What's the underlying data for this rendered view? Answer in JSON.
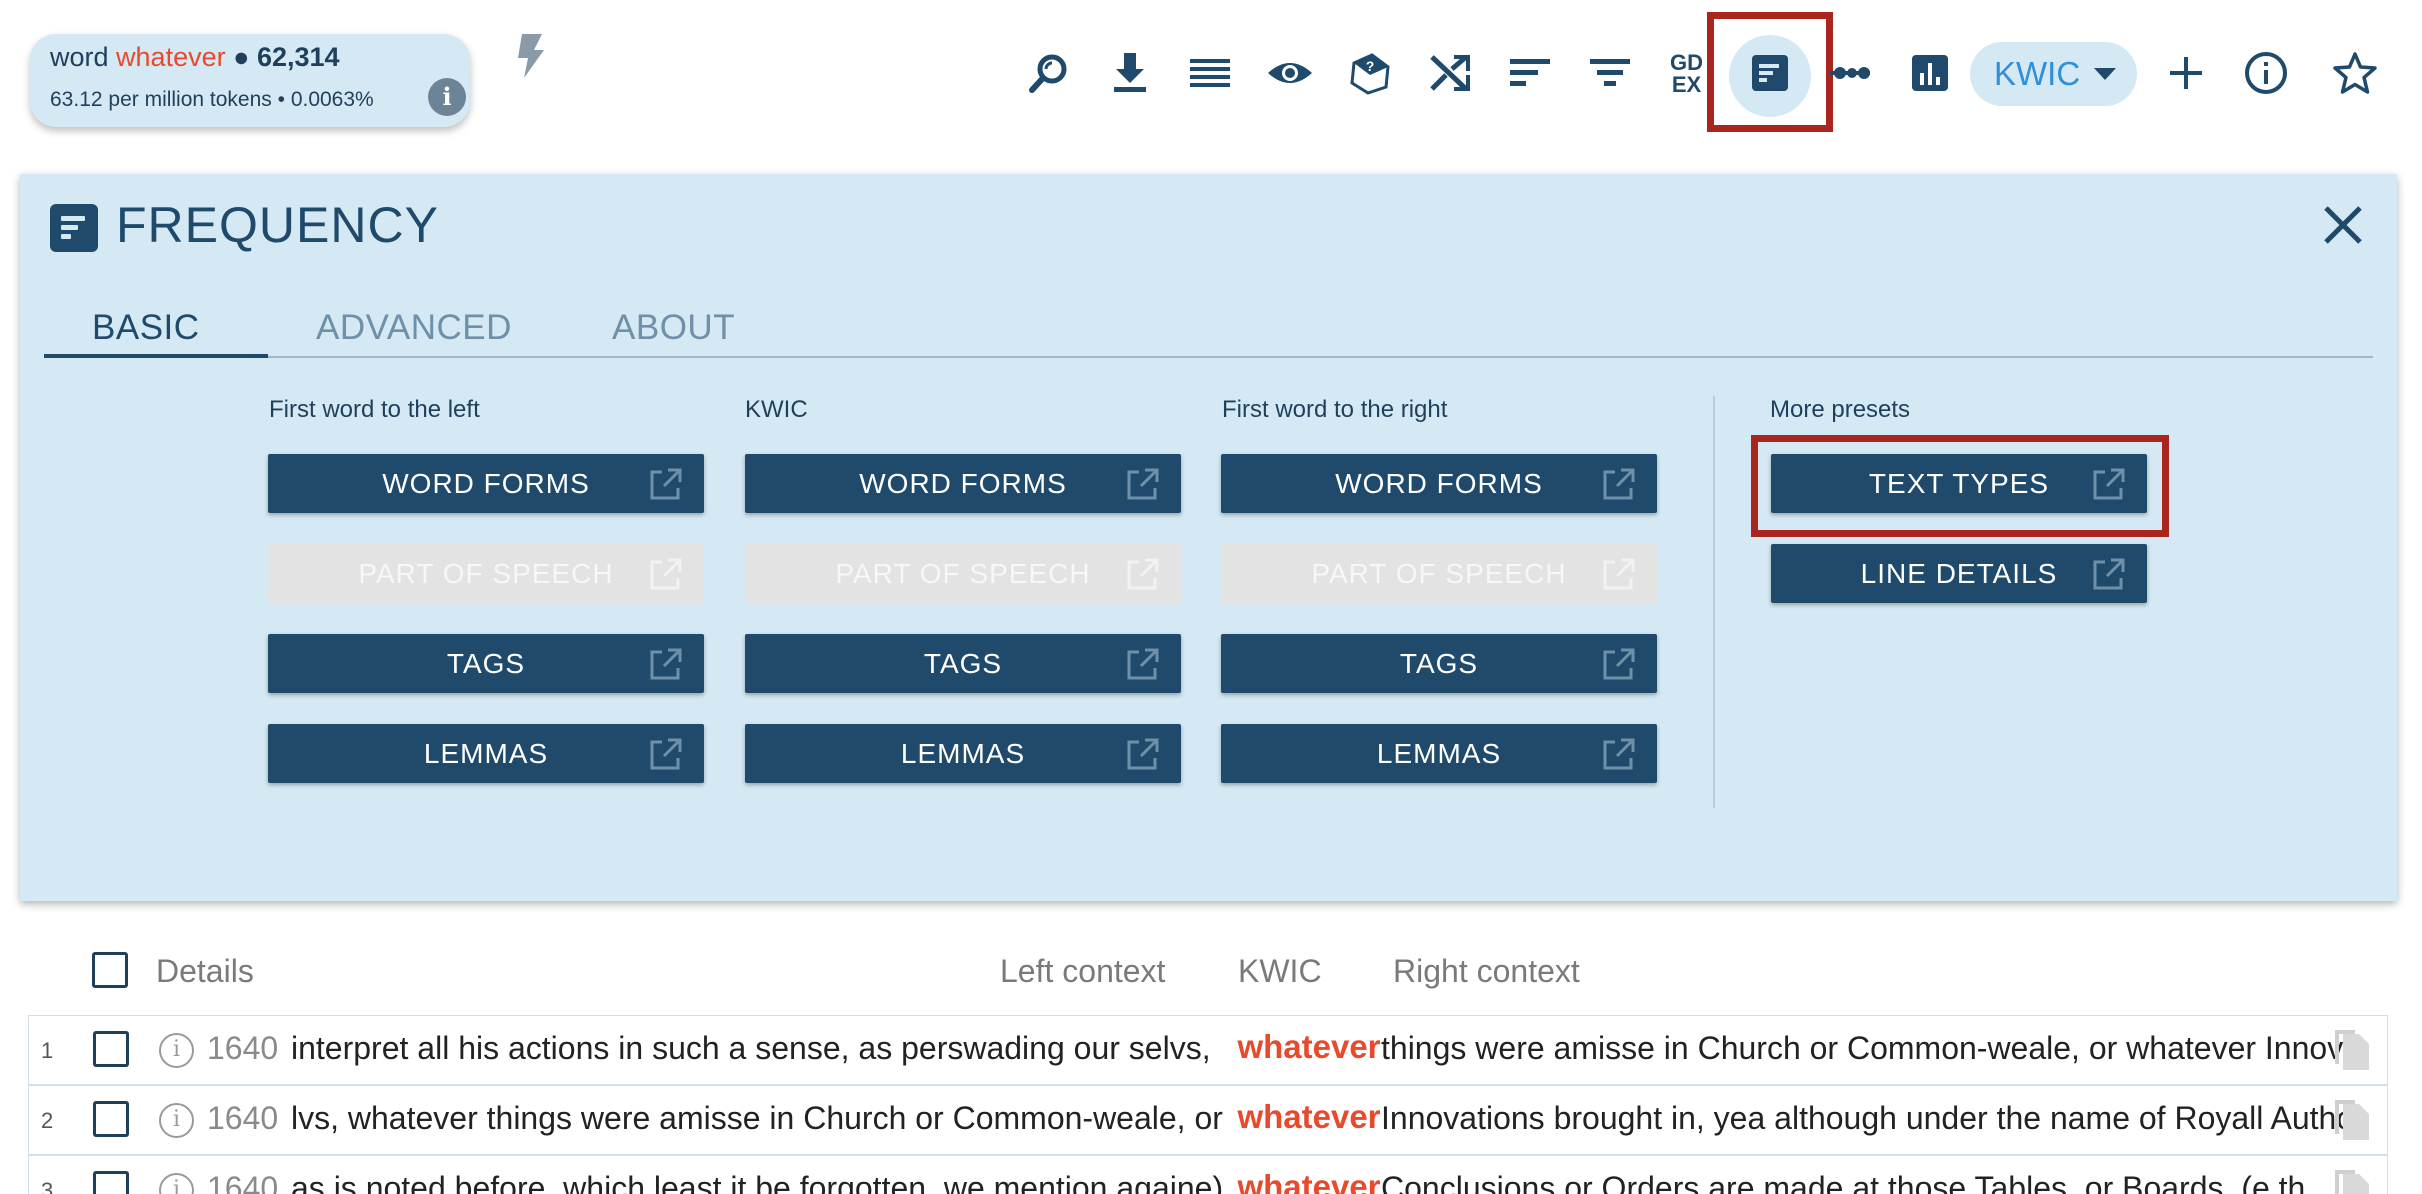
{
  "summary": {
    "attr": "word",
    "query": "whatever",
    "count": "62,314",
    "stats": "63.12 per million tokens • 0.0063%",
    "info_glyph": "i"
  },
  "toolbar": {
    "icons": [
      "search-refine-icon",
      "download-icon",
      "view-options-icon",
      "visibility-icon",
      "good-example-icon",
      "shuffle-icon",
      "sort-icon",
      "filter-icon",
      "gdex-icon",
      "frequency-icon",
      "collocations-icon",
      "visualize-icon",
      "add-icon",
      "info-icon",
      "star-icon"
    ],
    "gdex_line1": "GD",
    "gdex_line2": "EX",
    "view_mode": "KWIC"
  },
  "panel": {
    "title": "FREQUENCY",
    "tabs": [
      "BASIC",
      "ADVANCED",
      "ABOUT"
    ],
    "active_tab": "BASIC",
    "columns": [
      {
        "label": "First word to the left",
        "buttons": [
          "WORD FORMS",
          "PART OF SPEECH",
          "TAGS",
          "LEMMAS"
        ]
      },
      {
        "label": "KWIC",
        "buttons": [
          "WORD FORMS",
          "PART OF SPEECH",
          "TAGS",
          "LEMMAS"
        ]
      },
      {
        "label": "First word to the right",
        "buttons": [
          "WORD FORMS",
          "PART OF SPEECH",
          "TAGS",
          "LEMMAS"
        ]
      }
    ],
    "disabled_button": "PART OF SPEECH",
    "more_presets": {
      "label": "More presets",
      "buttons": [
        "TEXT TYPES",
        "LINE DETAILS"
      ]
    }
  },
  "results": {
    "headers": {
      "details": "Details",
      "left": "Left context",
      "kwic": "KWIC",
      "right": "Right context"
    },
    "rows": [
      {
        "num": "1",
        "year": "1640",
        "left": "interpret all his actions in such a sense, as perswading our selvs,",
        "kwic": "whatever",
        "right": "things were amisse in Church or Common-weale, or whatever Innovations brought in"
      },
      {
        "num": "2",
        "year": "1640",
        "left": "lvs, whatever things were amisse in Church or Common-weale, or",
        "kwic": "whatever",
        "right": "Innovations brought in, yea although under the name of Royall Authority"
      },
      {
        "num": "3",
        "year": "1640",
        "left": "as is noted before, which least it be forgotten, we mention againe)",
        "kwic": "whatever",
        "right": "Conclusions or Orders are made at those Tables, or Boards, (e.th"
      }
    ]
  },
  "colors": {
    "primary": "#1f4a6b",
    "panel_bg": "#d4e9f4",
    "keyword": "#e84a2c",
    "highlight": "#a8261d",
    "link_blue": "#2f8fd8"
  }
}
